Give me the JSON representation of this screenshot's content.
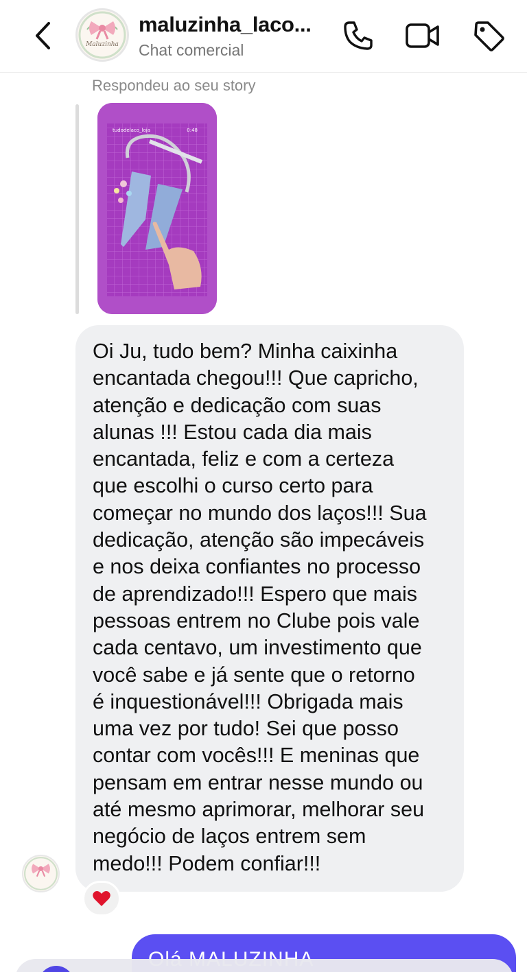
{
  "header": {
    "username": "maluzinha_laco...",
    "subtitle": "Chat comercial",
    "logo_text": "Maluzinha",
    "icons": [
      "back-chevron-icon",
      "phone-icon",
      "video-camera-icon",
      "tag-icon"
    ]
  },
  "story_reply": {
    "label": "Respondeu ao seu story",
    "thumbnail": {
      "account": "tudodelaco_loja",
      "duration": "0:48"
    }
  },
  "message": {
    "text": "Oi Ju, tudo bem? Minha caixinha\nencantada chegou!!! Que capricho,\natenção  e dedicação com suas\nalunas !!! Estou cada dia mais\nencantada, feliz e com a certeza\nque escolhi o curso certo para\ncomeçar no mundo dos laços!!! Sua\ndedicação, atenção são impecáveis\ne nos deixa confiantes no processo\nde aprendizado!!!  Espero que mais\npessoas entrem no Clube pois vale\ncada centavo, um investimento que\nvocê sabe e já sente que o retorno\né inquestionável!!! Obrigada mais\numa vez por tudo! Sei que posso\ncontar com vocês!!! E meninas que\npensam em entrar nesse mundo ou\naté mesmo aprimorar, melhorar seu\nnegócio de laços entrem sem\nmedo!!! Podem confiar!!!",
    "reaction": "❤️"
  },
  "sent_message": {
    "text": "Olá MALUZINHA"
  },
  "colors": {
    "sent_bubble": "#5b4ff2",
    "received_bubble": "#eff0f2",
    "reaction_heart": "#e0142c",
    "story_background": "#b455c9"
  }
}
